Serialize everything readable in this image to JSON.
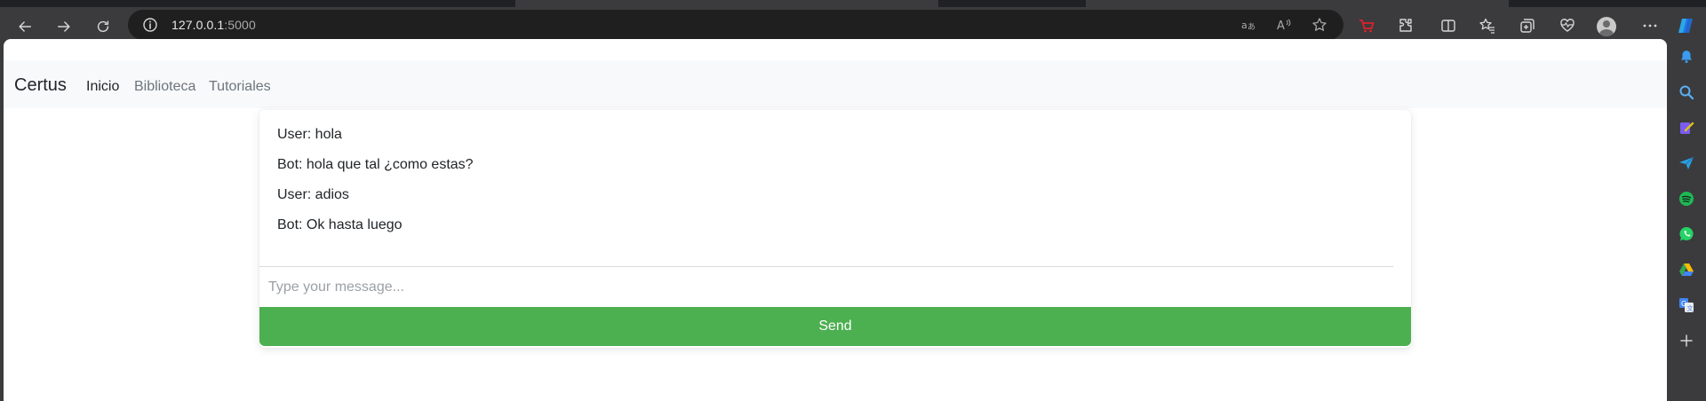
{
  "browser": {
    "url_host": "127.0.0.1",
    "url_port": ":5000",
    "icons": {
      "back": "arrow-left-icon",
      "forward": "arrow-right-icon",
      "reload": "refresh-icon",
      "site_info": "info-icon",
      "translate": "translate-icon",
      "read_aloud": "read-aloud-icon",
      "favorite": "star-icon",
      "extensions": "puzzle-icon",
      "split_screen": "split-screen-icon",
      "favorites_list": "favorites-icon",
      "collections": "collections-icon",
      "performance": "heart-pulse-icon",
      "profile": "avatar-icon",
      "more": "more-icon",
      "copilot": "copilot-icon"
    }
  },
  "sidebar_icons": [
    "bell-icon",
    "search-icon",
    "tools-icon",
    "send-icon",
    "spotify-icon",
    "whatsapp-icon",
    "drive-icon",
    "translate-icon",
    "plus-icon"
  ],
  "navbar": {
    "brand": "Certus",
    "links": [
      {
        "label": "Inicio",
        "active": true
      },
      {
        "label": "Biblioteca",
        "active": false
      },
      {
        "label": "Tutoriales",
        "active": false
      }
    ]
  },
  "chat": {
    "messages": [
      "User: hola",
      "Bot: hola que tal ¿como estas?",
      "User: adios",
      "Bot: Ok hasta luego"
    ],
    "input_value": "",
    "input_placeholder": "Type your message...",
    "send_label": "Send"
  },
  "colors": {
    "send_button": "#4caf50",
    "navbar_bg": "#f8f9fa",
    "browser_chrome": "#3b3b3d"
  }
}
